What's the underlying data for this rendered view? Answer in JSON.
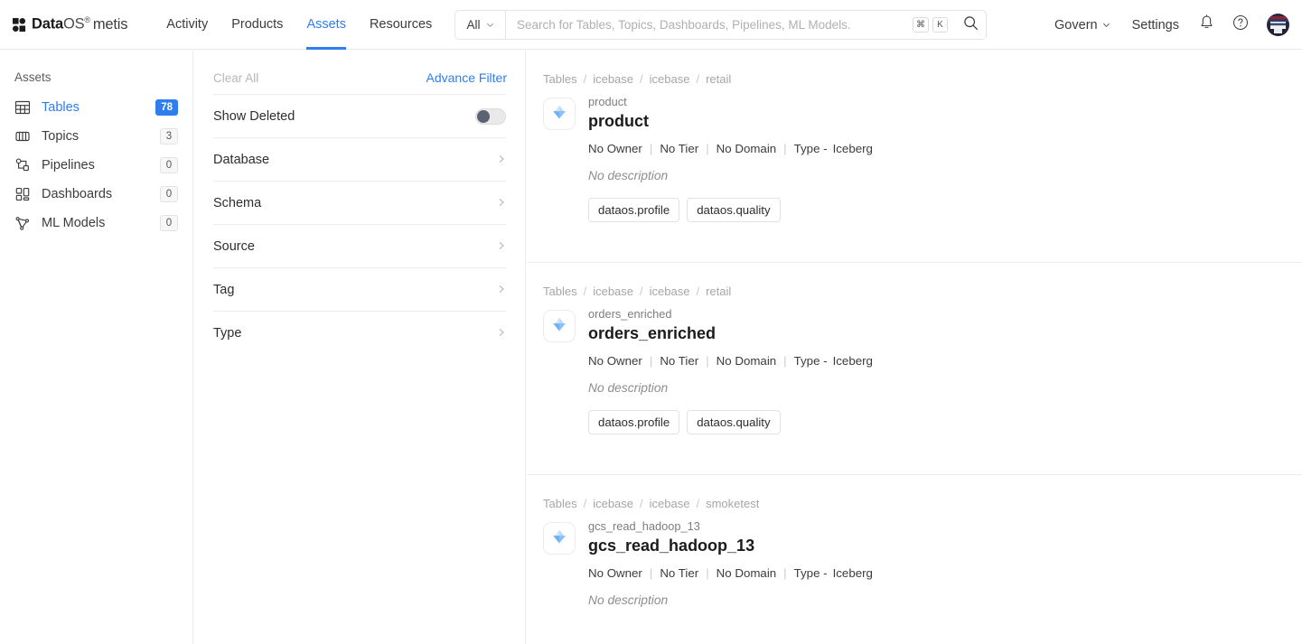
{
  "header": {
    "logo": {
      "bold": "Data",
      "light": "OS",
      "reg": "®",
      "product": "metis",
      "icon": "dataos-logo-icon"
    },
    "nav": [
      {
        "label": "Activity",
        "active": false
      },
      {
        "label": "Products",
        "active": false
      },
      {
        "label": "Assets",
        "active": true
      },
      {
        "label": "Resources",
        "active": false
      }
    ],
    "search": {
      "scope": "All",
      "placeholder": "Search for Tables, Topics, Dashboards, Pipelines, ML Models.",
      "value": "",
      "kbd_modifier": "⌘",
      "kbd_key": "K",
      "search_icon": "search-icon"
    },
    "right": {
      "govern": "Govern",
      "settings": "Settings",
      "bell_icon": "bell-icon",
      "help_icon": "help-circle-icon",
      "avatar": "user-avatar"
    },
    "accent_color": "#2f7ef0"
  },
  "sidebar": {
    "title": "Assets",
    "items": [
      {
        "label": "Tables",
        "count": "78",
        "icon": "table-icon",
        "active": true
      },
      {
        "label": "Topics",
        "count": "3",
        "icon": "topic-icon",
        "active": false
      },
      {
        "label": "Pipelines",
        "count": "0",
        "icon": "pipeline-icon",
        "active": false
      },
      {
        "label": "Dashboards",
        "count": "0",
        "icon": "dashboard-icon",
        "active": false
      },
      {
        "label": "ML Models",
        "count": "0",
        "icon": "ml-model-icon",
        "active": false
      }
    ]
  },
  "filters": {
    "clear_all": "Clear All",
    "advance_filter": "Advance Filter",
    "show_deleted": {
      "label": "Show Deleted",
      "on": false
    },
    "groups": [
      {
        "label": "Database"
      },
      {
        "label": "Schema"
      },
      {
        "label": "Source"
      },
      {
        "label": "Tag"
      },
      {
        "label": "Type"
      }
    ]
  },
  "results": [
    {
      "breadcrumb": [
        "Tables",
        "icebase",
        "icebase",
        "retail"
      ],
      "icon": "iceberg-table-icon",
      "sub_name": "product",
      "title": "product",
      "owner": "No Owner",
      "tier": "No Tier",
      "domain": "No Domain",
      "type_label": "Type -",
      "type_value": "Iceberg",
      "description": "No description",
      "tags": [
        "dataos.profile",
        "dataos.quality"
      ]
    },
    {
      "breadcrumb": [
        "Tables",
        "icebase",
        "icebase",
        "retail"
      ],
      "icon": "iceberg-table-icon",
      "sub_name": "orders_enriched",
      "title": "orders_enriched",
      "owner": "No Owner",
      "tier": "No Tier",
      "domain": "No Domain",
      "type_label": "Type -",
      "type_value": "Iceberg",
      "description": "No description",
      "tags": [
        "dataos.profile",
        "dataos.quality"
      ]
    },
    {
      "breadcrumb": [
        "Tables",
        "icebase",
        "icebase",
        "smoketest"
      ],
      "icon": "iceberg-table-icon",
      "sub_name": "gcs_read_hadoop_13",
      "title": "gcs_read_hadoop_13",
      "owner": "No Owner",
      "tier": "No Tier",
      "domain": "No Domain",
      "type_label": "Type -",
      "type_value": "Iceberg",
      "description": "No description",
      "tags": []
    }
  ]
}
